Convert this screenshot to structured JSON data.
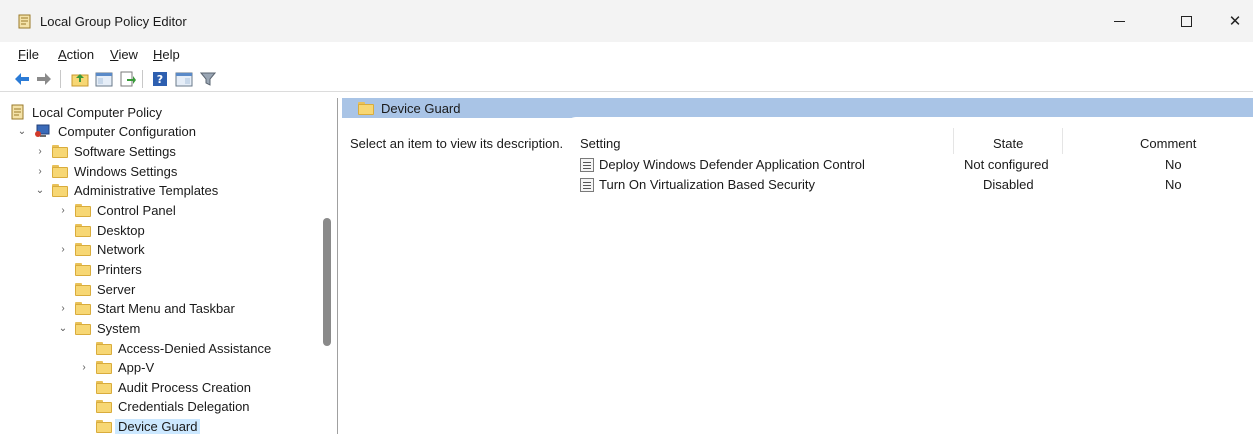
{
  "window": {
    "title": "Local Group Policy Editor",
    "controls": {
      "minimize": "—",
      "close": "✕"
    }
  },
  "menu": [
    {
      "underlined": "F",
      "rest": "ile"
    },
    {
      "underlined": "A",
      "rest": "ction"
    },
    {
      "underlined": "V",
      "rest": "iew"
    },
    {
      "underlined": "H",
      "rest": "elp"
    }
  ],
  "toolbar": {
    "icons": [
      "back-arrow-icon",
      "forward-arrow-icon",
      "up-folder-icon",
      "show-hide-tree-icon",
      "export-list-icon",
      "help-icon",
      "properties-view-icon",
      "filter-icon"
    ]
  },
  "tree": {
    "items": [
      {
        "label": "Local Computer Policy",
        "level": 0,
        "chevron": "",
        "icon": "policy-root-icon"
      },
      {
        "label": "Computer Configuration",
        "level": 1,
        "chevron": "⌄",
        "icon": "computer-config-icon"
      },
      {
        "label": "Software Settings",
        "level": 2,
        "chevron": "›",
        "icon": "folder-icon"
      },
      {
        "label": "Windows Settings",
        "level": 2,
        "chevron": "›",
        "icon": "folder-icon"
      },
      {
        "label": "Administrative Templates",
        "level": 2,
        "chevron": "⌄",
        "icon": "folder-icon"
      },
      {
        "label": "Control Panel",
        "level": 3,
        "chevron": "›",
        "icon": "folder-icon"
      },
      {
        "label": "Desktop",
        "level": 3,
        "chevron": "",
        "icon": "folder-icon"
      },
      {
        "label": "Network",
        "level": 3,
        "chevron": "›",
        "icon": "folder-icon"
      },
      {
        "label": "Printers",
        "level": 3,
        "chevron": "",
        "icon": "folder-icon"
      },
      {
        "label": "Server",
        "level": 3,
        "chevron": "",
        "icon": "folder-icon"
      },
      {
        "label": "Start Menu and Taskbar",
        "level": 3,
        "chevron": "›",
        "icon": "folder-icon"
      },
      {
        "label": "System",
        "level": 3,
        "chevron": "⌄",
        "icon": "folder-icon"
      },
      {
        "label": "Access-Denied Assistance",
        "level": 4,
        "chevron": "",
        "icon": "folder-icon"
      },
      {
        "label": "App-V",
        "level": 4,
        "chevron": "›",
        "icon": "folder-icon"
      },
      {
        "label": "Audit Process Creation",
        "level": 4,
        "chevron": "",
        "icon": "folder-icon"
      },
      {
        "label": "Credentials Delegation",
        "level": 4,
        "chevron": "",
        "icon": "folder-icon"
      },
      {
        "label": "Device Guard",
        "level": 4,
        "chevron": "",
        "icon": "folder-icon",
        "selected": true
      }
    ]
  },
  "right_pane": {
    "header": "Device Guard",
    "description": "Select an item to view its description.",
    "columns": {
      "setting": "Setting",
      "state": "State",
      "comment": "Comment"
    },
    "rows": [
      {
        "setting": "Deploy Windows Defender Application Control",
        "state": "Not configured",
        "comment": "No"
      },
      {
        "setting": "Turn On Virtualization Based Security",
        "state": "Disabled",
        "comment": "No"
      }
    ]
  },
  "colors": {
    "header_band": "#a9c4e6",
    "selection": "#cce8ff",
    "folder": "#f7d774"
  }
}
